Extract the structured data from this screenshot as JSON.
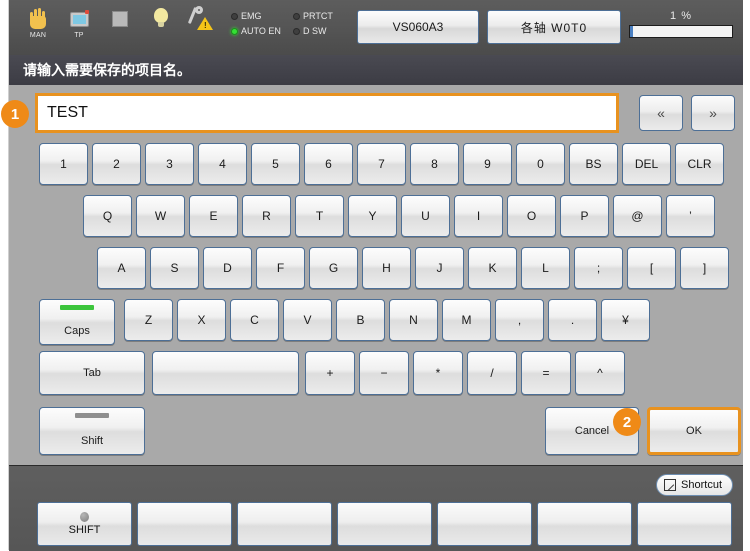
{
  "header": {
    "icons": [
      {
        "name": "manual-mode-icon",
        "caption": "MAN"
      },
      {
        "name": "teach-pendant-icon",
        "caption": "TP"
      },
      {
        "name": "stop-square-icon",
        "caption": ""
      },
      {
        "name": "lamp-icon",
        "caption": ""
      },
      {
        "name": "maintenance-warning-icon",
        "caption": ""
      }
    ],
    "status_leds": [
      {
        "label": "EMG",
        "on": false
      },
      {
        "label": "PRTCT",
        "on": false
      },
      {
        "label": "AUTO EN",
        "on": true
      },
      {
        "label": "D SW",
        "on": false
      }
    ],
    "model_button": "VS060A3",
    "axis_button": "各轴 W0T0",
    "speed": {
      "value": "1 %",
      "percent": 1
    }
  },
  "title": "请输入需要保存的项目名。",
  "input": {
    "value": "TEST",
    "prev_label": "«",
    "next_label": "»"
  },
  "badges": [
    {
      "id": "1",
      "label": "1"
    },
    {
      "id": "2",
      "label": "2"
    }
  ],
  "keyboard": {
    "row_numbers": [
      "1",
      "2",
      "3",
      "4",
      "5",
      "6",
      "7",
      "8",
      "9",
      "0",
      "BS",
      "DEL",
      "CLR"
    ],
    "row_qwerty": [
      "Q",
      "W",
      "E",
      "R",
      "T",
      "Y",
      "U",
      "I",
      "O",
      "P",
      "@",
      "’"
    ],
    "row_asdf": [
      "A",
      "S",
      "D",
      "F",
      "G",
      "H",
      "J",
      "K",
      "L",
      ";",
      "[",
      "]"
    ],
    "row_zxcv": [
      "Z",
      "X",
      "C",
      "V",
      "B",
      "N",
      "M",
      ",",
      ".",
      "¥"
    ],
    "row_symbols": [
      "+",
      "−",
      "*",
      "/",
      "=",
      "^"
    ],
    "caps_label": "Caps",
    "caps_led_on": true,
    "tab_label": "Tab",
    "space_label": "",
    "shift_label": "Shift",
    "shift_led_on": false,
    "cancel_label": "Cancel",
    "ok_label": "OK"
  },
  "footer": {
    "shortcut_label": "Shortcut",
    "function_keys": [
      {
        "label": "SHIFT",
        "has_dot": true
      },
      {
        "label": "",
        "has_dot": false
      },
      {
        "label": "",
        "has_dot": false
      },
      {
        "label": "",
        "has_dot": false
      },
      {
        "label": "",
        "has_dot": false
      },
      {
        "label": "",
        "has_dot": false
      },
      {
        "label": "",
        "has_dot": false
      }
    ]
  },
  "colors": {
    "accent_orange": "#e8921f",
    "led_green": "#34e034",
    "panel_gray": "#a9a9a9"
  }
}
